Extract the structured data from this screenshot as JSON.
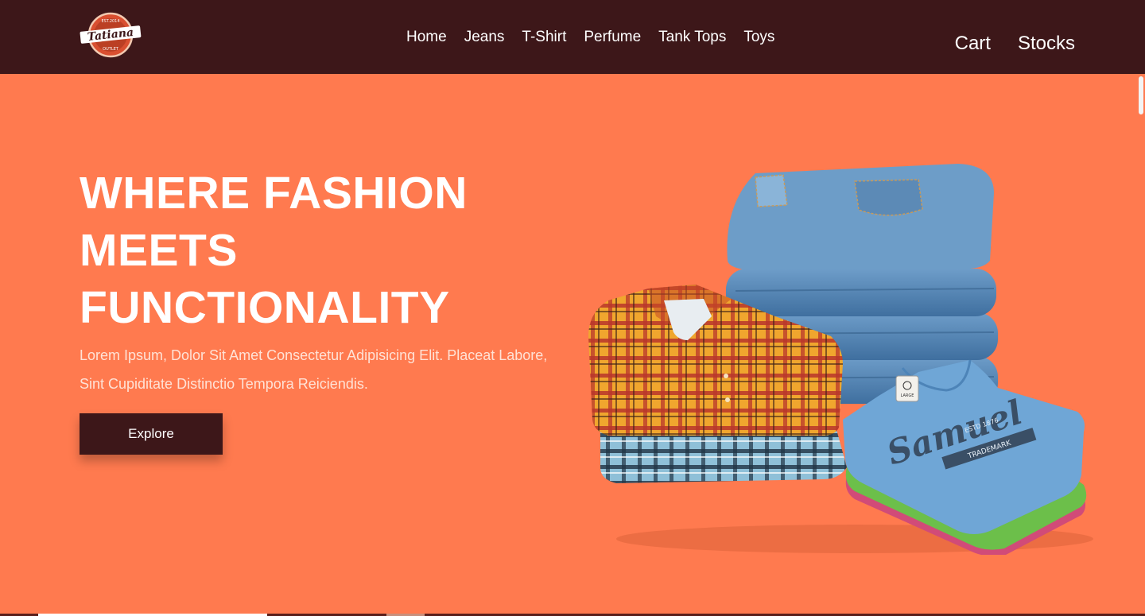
{
  "brand": {
    "logo_top": "EST.2014",
    "logo_name": "Tatiana",
    "logo_bottom": "OUTLET"
  },
  "nav": {
    "links": [
      "Home",
      "Jeans",
      "T-Shirt",
      "Perfume",
      "Tank Tops",
      "Toys"
    ],
    "cart_label": "Cart",
    "stocks_label": "Stocks"
  },
  "hero": {
    "title_line1": "WHERE FASHION",
    "title_line2": "MEETS",
    "title_line3": "FUNCTIONALITY",
    "description": "Lorem Ipsum, Dolor Sit Amet Consectetur Adipisicing Elit. Placeat Labore, Sint Cupiditate Distinctio Tempora Reiciendis.",
    "explore_label": "Explore",
    "tshirt_print": "Samuel",
    "tshirt_sub": "ESTD 1876",
    "tshirt_banner": "TRADEMARK",
    "tag_text": "LARGE"
  },
  "colors": {
    "navbar": "#3d1719",
    "hero_bg": "#ff7a4f",
    "button": "#3d1719"
  }
}
